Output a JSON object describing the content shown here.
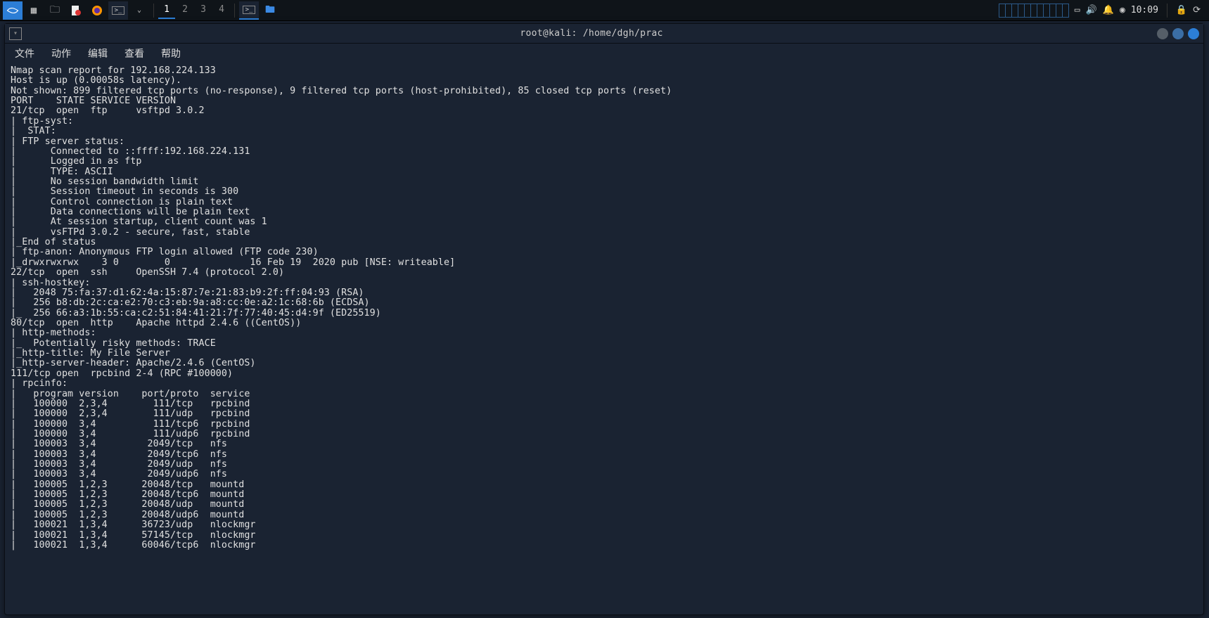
{
  "taskbar": {
    "workspaces": [
      "1",
      "2",
      "3",
      "4"
    ],
    "active_workspace": 0,
    "clock": "10:09"
  },
  "window": {
    "title": "root@kali: /home/dgh/prac"
  },
  "menubar": {
    "items": [
      "文件",
      "动作",
      "编辑",
      "查看",
      "帮助"
    ]
  },
  "terminal": {
    "lines": [
      "Nmap scan report for 192.168.224.133",
      "Host is up (0.00058s latency).",
      "Not shown: 899 filtered tcp ports (no-response), 9 filtered tcp ports (host-prohibited), 85 closed tcp ports (reset)",
      "PORT    STATE SERVICE VERSION",
      "21/tcp  open  ftp     vsftpd 3.0.2",
      "| ftp-syst:",
      "|  STAT:",
      "| FTP server status:",
      "|      Connected to ::ffff:192.168.224.131",
      "|      Logged in as ftp",
      "|      TYPE: ASCII",
      "|      No session bandwidth limit",
      "|      Session timeout in seconds is 300",
      "|      Control connection is plain text",
      "|      Data connections will be plain text",
      "|      At session startup, client count was 1",
      "|      vsFTPd 3.0.2 - secure, fast, stable",
      "|_End of status",
      "| ftp-anon: Anonymous FTP login allowed (FTP code 230)",
      "|_drwxrwxrwx    3 0        0              16 Feb 19  2020 pub [NSE: writeable]",
      "22/tcp  open  ssh     OpenSSH 7.4 (protocol 2.0)",
      "| ssh-hostkey:",
      "|   2048 75:fa:37:d1:62:4a:15:87:7e:21:83:b9:2f:ff:04:93 (RSA)",
      "|   256 b8:db:2c:ca:e2:70:c3:eb:9a:a8:cc:0e:a2:1c:68:6b (ECDSA)",
      "|_  256 66:a3:1b:55:ca:c2:51:84:41:21:7f:77:40:45:d4:9f (ED25519)",
      "80/tcp  open  http    Apache httpd 2.4.6 ((CentOS))",
      "| http-methods:",
      "|_  Potentially risky methods: TRACE",
      "|_http-title: My File Server",
      "|_http-server-header: Apache/2.4.6 (CentOS)",
      "111/tcp open  rpcbind 2-4 (RPC #100000)",
      "| rpcinfo:",
      "|   program version    port/proto  service",
      "|   100000  2,3,4        111/tcp   rpcbind",
      "|   100000  2,3,4        111/udp   rpcbind",
      "|   100000  3,4          111/tcp6  rpcbind",
      "|   100000  3,4          111/udp6  rpcbind",
      "|   100003  3,4         2049/tcp   nfs",
      "|   100003  3,4         2049/tcp6  nfs",
      "|   100003  3,4         2049/udp   nfs",
      "|   100003  3,4         2049/udp6  nfs",
      "|   100005  1,2,3      20048/tcp   mountd",
      "|   100005  1,2,3      20048/tcp6  mountd",
      "|   100005  1,2,3      20048/udp   mountd",
      "|   100005  1,2,3      20048/udp6  mountd",
      "|   100021  1,3,4      36723/udp   nlockmgr",
      "|   100021  1,3,4      57145/tcp   nlockmgr",
      "|   100021  1,3,4      60046/tcp6  nlockmgr"
    ]
  }
}
